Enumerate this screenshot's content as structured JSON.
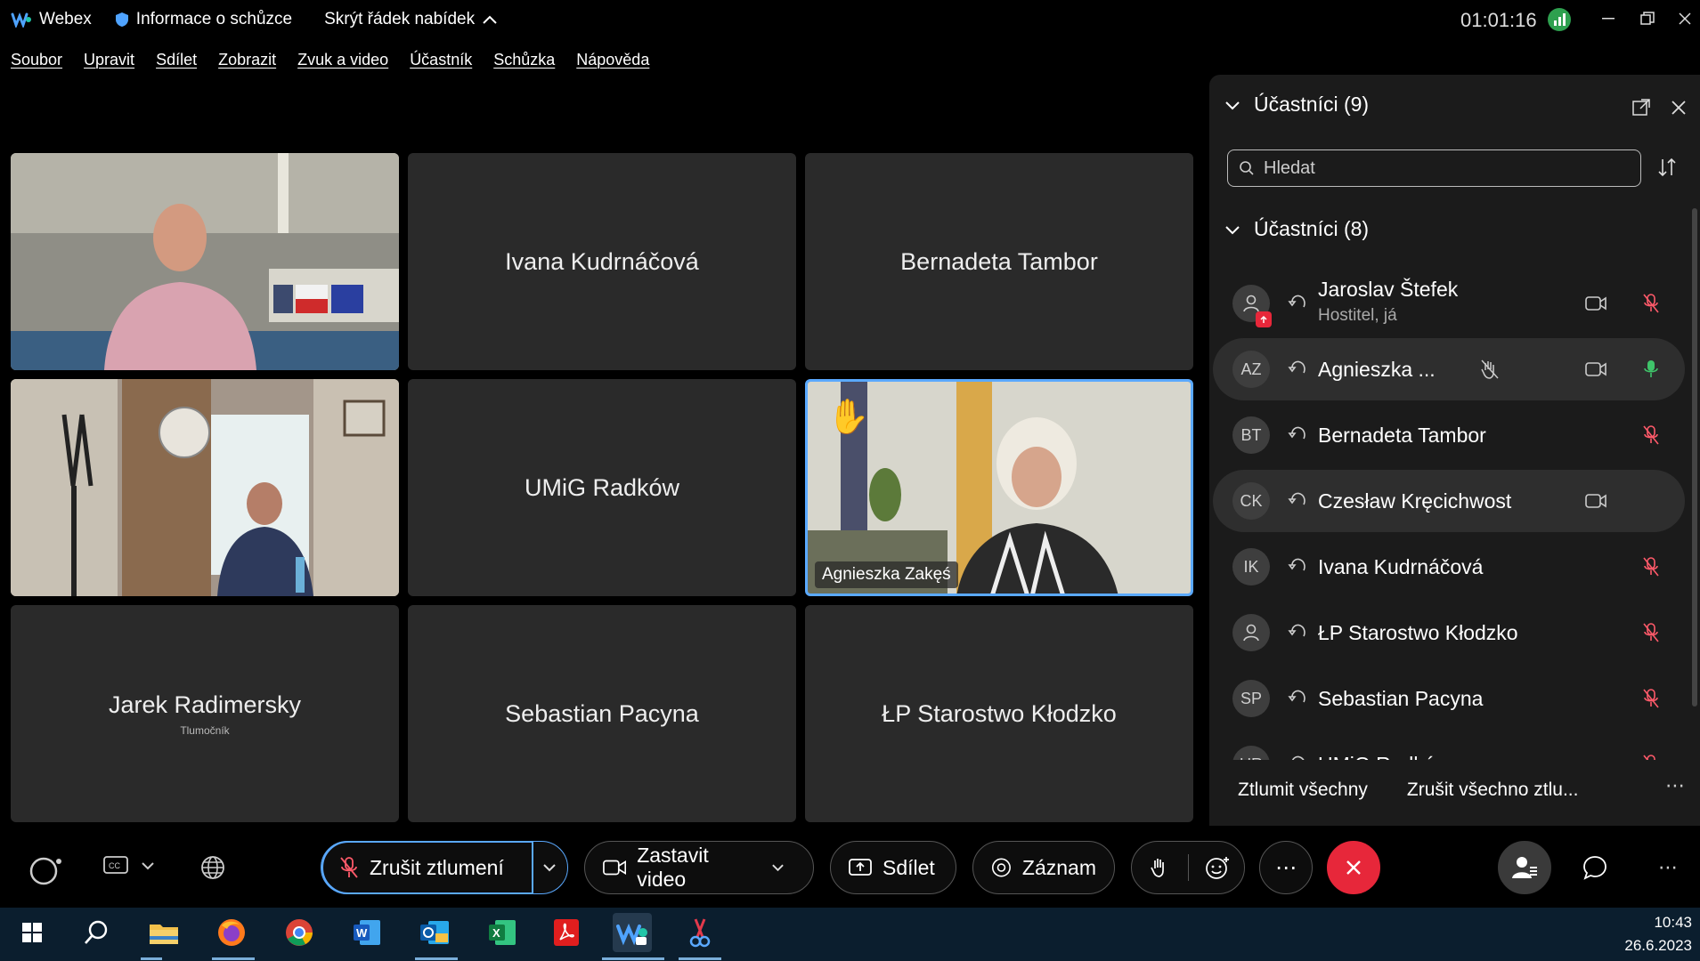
{
  "titlebar": {
    "app_name": "Webex",
    "meeting_info": "Informace o schůzce",
    "hide_menu": "Skrýt řádek nabídek",
    "timer": "01:01:16"
  },
  "menu": [
    "Soubor",
    "Upravit",
    "Sdílet",
    "Zobrazit",
    "Zvuk a video",
    "Účastník",
    "Schůzka",
    "Nápověda"
  ],
  "tiles": {
    "t1_name": "",
    "t2_name": "Ivana Kudrnáčová",
    "t3_name": "Bernadeta Tambor",
    "t5_name": "UMiG Radków",
    "t6_name": "Agnieszka Zakęś",
    "t7_name": "Jarek Radimersky",
    "t7_sub": "Tlumočník",
    "t8_name": "Sebastian Pacyna",
    "t9_name": "ŁP Starostwo Kłodzko"
  },
  "panel": {
    "title": "Účastníci (9)",
    "search_placeholder": "Hledat",
    "section": "Účastníci (8)",
    "participants": [
      {
        "initials": "",
        "name": "Jaroslav Štefek",
        "role": "Hostitel, já"
      },
      {
        "initials": "AZ",
        "name": "Agnieszka ..."
      },
      {
        "initials": "BT",
        "name": "Bernadeta Tambor"
      },
      {
        "initials": "CK",
        "name": "Czesław Kręcichwost"
      },
      {
        "initials": "IK",
        "name": "Ivana Kudrnáčová"
      },
      {
        "initials": "",
        "name": "ŁP Starostwo Kłodzko"
      },
      {
        "initials": "SP",
        "name": "Sebastian Pacyna"
      },
      {
        "initials": "UR",
        "name": "UMiG Radków"
      }
    ],
    "mute_all": "Ztlumit všechny",
    "unmute_all": "Zrušit všechno ztlu..."
  },
  "controls": {
    "unmute": "Zrušit ztlumení",
    "stop_video": "Zastavit video",
    "share": "Sdílet",
    "record": "Záznam"
  },
  "taskbar": {
    "time": "10:43",
    "date": "26.6.2023"
  },
  "colors": {
    "accent_blue": "#5aa9ff",
    "end_red": "#e7273a",
    "muted_red": "#ff5a6a",
    "unmuted_green": "#3fc46a"
  }
}
